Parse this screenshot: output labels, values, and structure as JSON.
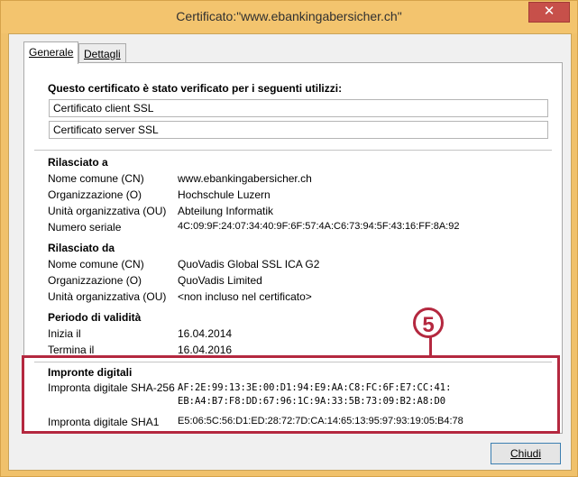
{
  "window": {
    "title": "Certificato:\"www.ebankingabersicher.ch\"",
    "close_symbol": "✕"
  },
  "tabs": [
    {
      "label": "Generale"
    },
    {
      "label": "Dettagli"
    }
  ],
  "usage": {
    "heading": "Questo certificato è stato verificato per i seguenti utilizzi:",
    "items": [
      "Certificato client SSL",
      "Certificato server SSL"
    ]
  },
  "issued_to": {
    "heading": "Rilasciato a",
    "rows": [
      {
        "label": "Nome comune (CN)",
        "value": "www.ebankingabersicher.ch"
      },
      {
        "label": "Organizzazione (O)",
        "value": "Hochschule Luzern"
      },
      {
        "label": "Unità organizzativa (OU)",
        "value": "Abteilung Informatik"
      },
      {
        "label": "Numero seriale",
        "value": "4C:09:9F:24:07:34:40:9F:6F:57:4A:C6:73:94:5F:43:16:FF:8A:92"
      }
    ]
  },
  "issued_by": {
    "heading": "Rilasciato da",
    "rows": [
      {
        "label": "Nome comune (CN)",
        "value": "QuoVadis Global SSL ICA G2"
      },
      {
        "label": "Organizzazione (O)",
        "value": "QuoVadis Limited"
      },
      {
        "label": "Unità organizzativa (OU)",
        "value": "<non incluso nel certificato>"
      }
    ]
  },
  "validity": {
    "heading": "Periodo di validità",
    "rows": [
      {
        "label": "Inizia il",
        "value": "16.04.2014"
      },
      {
        "label": "Termina il",
        "value": "16.04.2016"
      }
    ]
  },
  "fingerprints": {
    "heading": "Impronte digitali",
    "sha256_label": "Impronta digitale SHA-256",
    "sha256_line1": "AF:2E:99:13:3E:00:D1:94:E9:AA:C8:FC:6F:E7:CC:41:",
    "sha256_line2": "EB:A4:B7:F8:DD:67:96:1C:9A:33:5B:73:09:B2:A8:D0",
    "sha1_label": "Impronta digitale SHA1",
    "sha1_value": "E5:06:5C:56:D1:ED:28:72:7D:CA:14:65:13:95:97:93:19:05:B4:78"
  },
  "annotation": {
    "badge_number": "5",
    "highlight_color": "#b4283f"
  },
  "buttons": {
    "close_label": "Chiudi"
  }
}
